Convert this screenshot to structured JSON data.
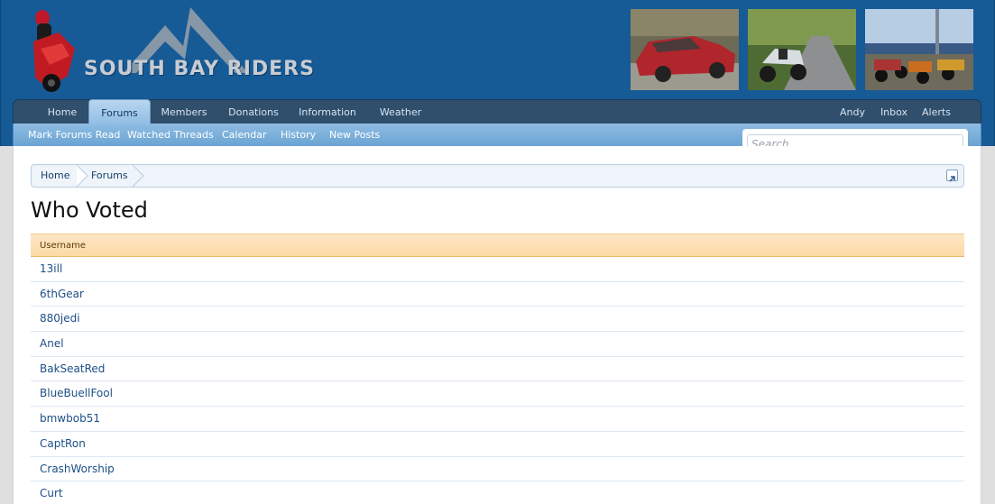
{
  "site": {
    "name": "SOUTH BAY RIDERS"
  },
  "colors": {
    "header": "#165a96",
    "navbar": "#2f4f6d",
    "subnav": "#7fb3de",
    "table_header": "#fcd9a6",
    "link": "#1d4f86"
  },
  "photos": [
    "red-car-photo",
    "motorcycle-on-road-photo",
    "motorcycle-group-photo"
  ],
  "nav": {
    "tabs": [
      {
        "label": "Home",
        "active": false
      },
      {
        "label": "Forums",
        "active": true
      },
      {
        "label": "Members",
        "active": false
      },
      {
        "label": "Donations",
        "active": false
      },
      {
        "label": "Information",
        "active": false
      },
      {
        "label": "Weather",
        "active": false
      }
    ],
    "user_links": [
      "Andy",
      "Inbox",
      "Alerts"
    ]
  },
  "subnav": {
    "links": [
      "Mark Forums Read",
      "Watched Threads",
      "Calendar",
      "History",
      "New Posts"
    ]
  },
  "search": {
    "placeholder": "Search..."
  },
  "breadcrumb": [
    "Home",
    "Forums"
  ],
  "page": {
    "title": "Who Voted"
  },
  "table": {
    "column": "Username",
    "voters": [
      "13ill",
      "6thGear",
      "880jedi",
      "Anel",
      "BakSeatRed",
      "BlueBuellFool",
      "bmwbob51",
      "CaptRon",
      "CrashWorship",
      "Curt"
    ]
  }
}
